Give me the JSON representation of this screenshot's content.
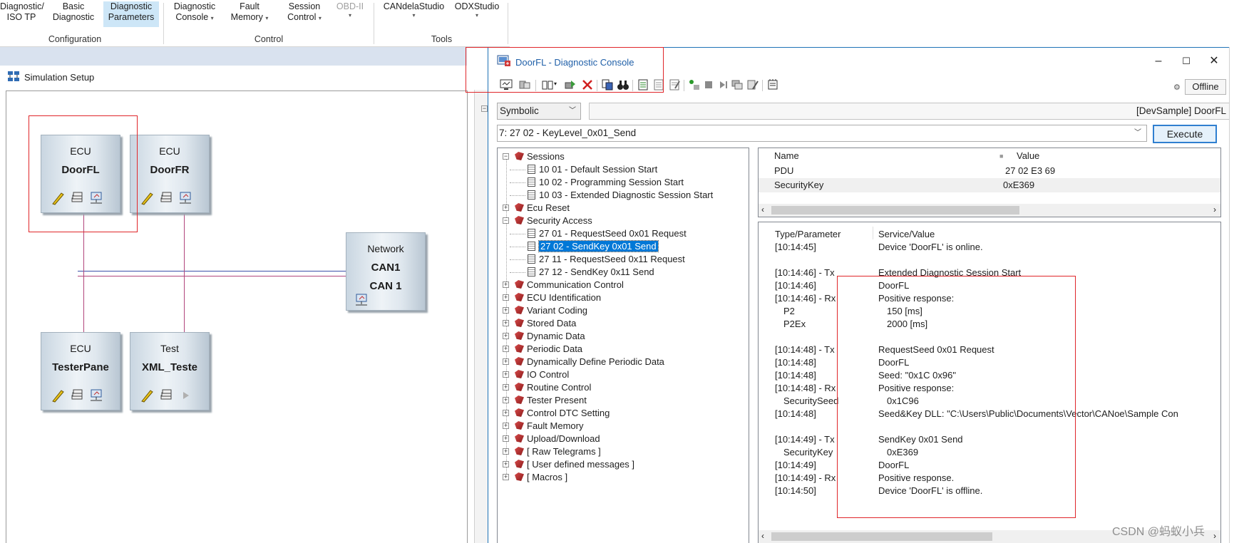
{
  "ribbon": {
    "buttons": [
      {
        "line1": "Diagnostic/",
        "line2": "ISO TP"
      },
      {
        "line1": "Basic",
        "line2": "Diagnostic"
      },
      {
        "line1": "Diagnostic",
        "line2": "Parameters"
      },
      {
        "line1": "Diagnostic",
        "line2": "Console"
      },
      {
        "line1": "Fault",
        "line2": "Memory"
      },
      {
        "line1": "Session",
        "line2": "Control"
      },
      {
        "line1": "OBD-II",
        "line2": ""
      },
      {
        "line1": "CANdelaStudio",
        "line2": ""
      },
      {
        "line1": "ODXStudio",
        "line2": ""
      }
    ],
    "groups": [
      "Configuration",
      "Control",
      "Tools"
    ]
  },
  "simulation": {
    "title": "Simulation Setup",
    "nodes": [
      {
        "type": "ECU",
        "name": "DoorFL"
      },
      {
        "type": "ECU",
        "name": "DoorFR"
      },
      {
        "type": "Network",
        "name": "CAN1",
        "name2": "CAN 1"
      },
      {
        "type": "ECU",
        "name": "TesterPane"
      },
      {
        "type": "Test",
        "name": "XML_Teste"
      }
    ]
  },
  "console": {
    "title": "DoorFL - Diagnostic Console",
    "offline_label": "Offline",
    "symbolic_select": "Symbolic",
    "path": "[DevSample] DoorFL",
    "service_select": "7: 27 02 - KeyLevel_0x01_Send",
    "execute_label": "Execute",
    "tree": [
      {
        "label": "Sessions",
        "level": 0,
        "expanded": true,
        "kind": "folder"
      },
      {
        "label": "10 01 - Default Session Start",
        "level": 1,
        "kind": "doc"
      },
      {
        "label": "10 02 - Programming Session Start",
        "level": 1,
        "kind": "doc"
      },
      {
        "label": "10 03 - Extended Diagnostic Session Start",
        "level": 1,
        "kind": "doc"
      },
      {
        "label": "Ecu Reset",
        "level": 0,
        "expanded": false,
        "kind": "folder"
      },
      {
        "label": "Security Access",
        "level": 0,
        "expanded": true,
        "kind": "folder"
      },
      {
        "label": "27 01 - RequestSeed 0x01 Request",
        "level": 1,
        "kind": "doc"
      },
      {
        "label": "27 02 - SendKey 0x01 Send",
        "level": 1,
        "kind": "doc",
        "selected": true
      },
      {
        "label": "27 11 - RequestSeed 0x11 Request",
        "level": 1,
        "kind": "doc"
      },
      {
        "label": "27 12 - SendKey 0x11 Send",
        "level": 1,
        "kind": "doc"
      },
      {
        "label": "Communication Control",
        "level": 0,
        "expanded": false,
        "kind": "folder"
      },
      {
        "label": "ECU Identification",
        "level": 0,
        "expanded": false,
        "kind": "folder"
      },
      {
        "label": "Variant Coding",
        "level": 0,
        "expanded": false,
        "kind": "folder"
      },
      {
        "label": "Stored Data",
        "level": 0,
        "expanded": false,
        "kind": "folder"
      },
      {
        "label": "Dynamic Data",
        "level": 0,
        "expanded": false,
        "kind": "folder"
      },
      {
        "label": "Periodic Data",
        "level": 0,
        "expanded": false,
        "kind": "folder"
      },
      {
        "label": "Dynamically Define Periodic Data",
        "level": 0,
        "expanded": false,
        "kind": "folder"
      },
      {
        "label": "IO Control",
        "level": 0,
        "expanded": false,
        "kind": "folder"
      },
      {
        "label": "Routine Control",
        "level": 0,
        "expanded": false,
        "kind": "folder"
      },
      {
        "label": "Tester Present",
        "level": 0,
        "expanded": false,
        "kind": "folder"
      },
      {
        "label": "Control DTC Setting",
        "level": 0,
        "expanded": false,
        "kind": "folder"
      },
      {
        "label": "Fault Memory",
        "level": 0,
        "expanded": false,
        "kind": "folder"
      },
      {
        "label": "Upload/Download",
        "level": 0,
        "expanded": false,
        "kind": "folder"
      },
      {
        "label": "[ Raw Telegrams ]",
        "level": 0,
        "expanded": false,
        "kind": "folder"
      },
      {
        "label": "[ User defined messages ]",
        "level": 0,
        "expanded": false,
        "kind": "folder"
      },
      {
        "label": "[ Macros ]",
        "level": 0,
        "expanded": false,
        "kind": "folder"
      }
    ],
    "pdu_grid": {
      "headers": [
        "Name",
        "Value"
      ],
      "rows": [
        {
          "name": "PDU",
          "value": "27 02 E3 69"
        },
        {
          "name": "SecurityKey",
          "value": "0xE369"
        }
      ]
    },
    "log": {
      "headers": [
        "Type/Parameter",
        "Service/Value"
      ],
      "rows": [
        {
          "c1": "[10:14:45]",
          "c2": "Device 'DoorFL' is online.",
          "indent1": false,
          "indent2": false
        },
        {
          "c1": "",
          "c2": "",
          "indent1": false,
          "indent2": false
        },
        {
          "c1": "[10:14:46] - Tx",
          "c2": "Extended Diagnostic Session Start",
          "indent1": false,
          "indent2": false
        },
        {
          "c1": "[10:14:46]",
          "c2": "DoorFL",
          "indent1": false,
          "indent2": false
        },
        {
          "c1": "[10:14:46] - Rx",
          "c2": "Positive response:",
          "indent1": false,
          "indent2": false
        },
        {
          "c1": "P2",
          "c2": "150 [ms]",
          "indent1": true,
          "indent2": true
        },
        {
          "c1": "P2Ex",
          "c2": "2000 [ms]",
          "indent1": true,
          "indent2": true
        },
        {
          "c1": "",
          "c2": "",
          "indent1": false,
          "indent2": false
        },
        {
          "c1": "[10:14:48] - Tx",
          "c2": "RequestSeed 0x01 Request",
          "indent1": false,
          "indent2": false
        },
        {
          "c1": "[10:14:48]",
          "c2": "DoorFL",
          "indent1": false,
          "indent2": false
        },
        {
          "c1": "[10:14:48]",
          "c2": "Seed: \"0x1C 0x96\"",
          "indent1": false,
          "indent2": false
        },
        {
          "c1": "[10:14:48] - Rx",
          "c2": "Positive response:",
          "indent1": false,
          "indent2": false
        },
        {
          "c1": "SecuritySeed",
          "c2": "0x1C96",
          "indent1": true,
          "indent2": true
        },
        {
          "c1": "[10:14:48]",
          "c2": "Seed&Key DLL: \"C:\\Users\\Public\\Documents\\Vector\\CANoe\\Sample Con",
          "indent1": false,
          "indent2": false
        },
        {
          "c1": "",
          "c2": "",
          "indent1": false,
          "indent2": false
        },
        {
          "c1": "[10:14:49] - Tx",
          "c2": "SendKey 0x01 Send",
          "indent1": false,
          "indent2": false
        },
        {
          "c1": "SecurityKey",
          "c2": "0xE369",
          "indent1": true,
          "indent2": true
        },
        {
          "c1": "[10:14:49]",
          "c2": "DoorFL",
          "indent1": false,
          "indent2": false
        },
        {
          "c1": "[10:14:49] - Rx",
          "c2": "Positive response.",
          "indent1": false,
          "indent2": false
        },
        {
          "c1": "[10:14:50]",
          "c2": "Device 'DoorFL' is offline.",
          "indent1": false,
          "indent2": false
        }
      ]
    }
  },
  "watermark": "CSDN @蚂蚁小兵",
  "colors": {
    "highlight": "#e0262a",
    "selection": "#0078d7",
    "accent": "#1f73b6"
  }
}
